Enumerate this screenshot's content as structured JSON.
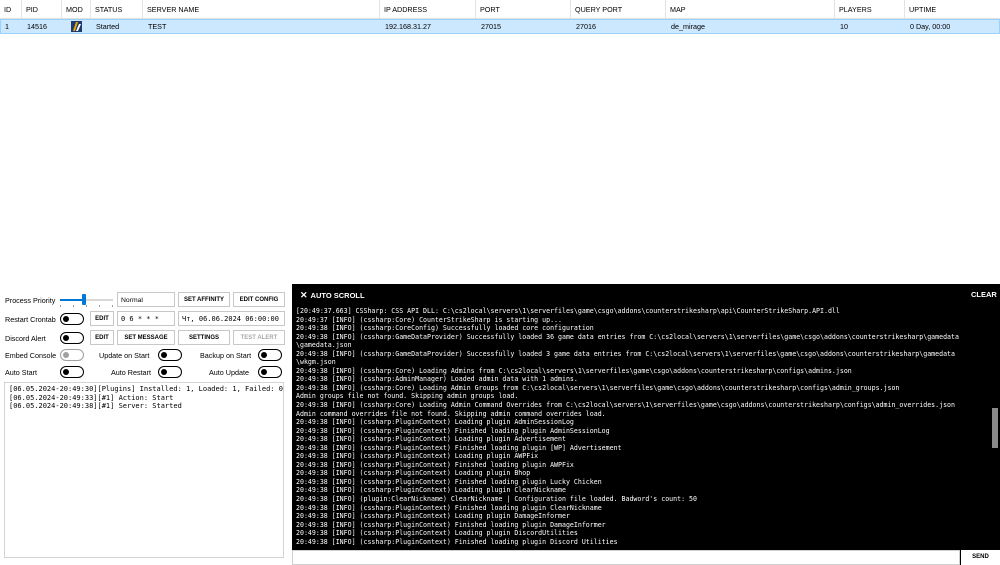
{
  "table": {
    "columns": [
      "ID",
      "PID",
      "MOD",
      "STATUS",
      "SERVER NAME",
      "IP ADDRESS",
      "PORT",
      "QUERY PORT",
      "MAP",
      "PLAYERS",
      "UPTIME"
    ],
    "rows": [
      {
        "id": "1",
        "pid": "14516",
        "mod_icon": "cs2-game-icon",
        "status": "Started",
        "server_name": "TEST",
        "ip": "192.168.31.27",
        "port": "27015",
        "query_port": "27016",
        "map": "de_mirage",
        "players": "10",
        "uptime": "0 Day, 00:00"
      }
    ]
  },
  "controls": {
    "process_priority_label": "Process Priority",
    "process_priority_level": 0.45,
    "priority_value": "Normal",
    "set_affinity": "SET AFFINITY",
    "edit_config": "EDIT CONFIG",
    "restart_crontab_label": "Restart Crontab",
    "edit": "EDIT",
    "crontab_value": "0 6 * * *",
    "next_restart": "Чт, 06.06.2024 06:00:00",
    "discord_alert_label": "Discord Alert",
    "set_message": "SET MESSAGE",
    "settings": "SETTINGS",
    "test_alert": "TEST ALERT",
    "embed_console_label": "Embed Console",
    "update_on_start_label": "Update on Start",
    "backup_on_start_label": "Backup on Start",
    "auto_start_label": "Auto Start",
    "auto_restart_label": "Auto Restart",
    "auto_update_label": "Auto Update"
  },
  "event_log": [
    "[06.05.2024-20:49:30][Plugins] Installed: 1, Loaded: 1, Failed: 0",
    "[06.05.2024-20:49:33][#1] Action: Start",
    "[06.05.2024-20:49:38][#1] Server: Started"
  ],
  "console": {
    "auto_scroll_label": "AUTO SCROLL",
    "clear_label": "CLEAR",
    "send_label": "SEND",
    "lines": [
      "[20:49:37.663] CSSharp: CSS API DLL: C:\\cs2local\\servers\\1\\serverfiles\\game\\csgo\\addons\\counterstrikesharp\\api\\CounterStrikeSharp.API.dll",
      "20:49:37 [INFO] (cssharp:Core) CounterStrikeSharp is starting up...",
      "20:49:38 [INFO] (cssharp:CoreConfig) Successfully loaded core configuration",
      "20:49:38 [INFO] (cssharp:GameDataProvider) Successfully loaded 36 game data entries from C:\\cs2local\\servers\\1\\serverfiles\\game\\csgo\\addons\\counterstrikesharp\\gamedata",
      "\\gamedata.json",
      "20:49:38 [INFO] (cssharp:GameDataProvider) Successfully loaded 3 game data entries from C:\\cs2local\\servers\\1\\serverfiles\\game\\csgo\\addons\\counterstrikesharp\\gamedata",
      "\\wkgm.json",
      "20:49:38 [INFO] (cssharp:Core) Loading Admins from C:\\cs2local\\servers\\1\\serverfiles\\game\\csgo\\addons\\counterstrikesharp\\configs\\admins.json",
      "20:49:38 [INFO] (cssharp:AdminManager) Loaded admin data with 1 admins.",
      "20:49:38 [INFO] (cssharp:Core) Loading Admin Groups from C:\\cs2local\\servers\\1\\serverfiles\\game\\csgo\\addons\\counterstrikesharp\\configs\\admin_groups.json",
      "Admin groups file not found. Skipping admin groups load.",
      "20:49:38 [INFO] (cssharp:Core) Loading Admin Command Overrides from C:\\cs2local\\servers\\1\\serverfiles\\game\\csgo\\addons\\counterstrikesharp\\configs\\admin_overrides.json",
      "Admin command overrides file not found. Skipping admin command overrides load.",
      "20:49:38 [INFO] (cssharp:PluginContext) Loading plugin AdminSessionLog",
      "20:49:38 [INFO] (cssharp:PluginContext) Finished loading plugin AdminSessionLog",
      "20:49:38 [INFO] (cssharp:PluginContext) Loading plugin Advertisement",
      "20:49:38 [INFO] (cssharp:PluginContext) Finished loading plugin [WP] Advertisement",
      "20:49:38 [INFO] (cssharp:PluginContext) Loading plugin AWPFix",
      "20:49:38 [INFO] (cssharp:PluginContext) Finished loading plugin AWPFix",
      "20:49:38 [INFO] (cssharp:PluginContext) Loading plugin Bhop",
      "20:49:38 [INFO] (cssharp:PluginContext) Finished loading plugin Lucky Chicken",
      "20:49:38 [INFO] (cssharp:PluginContext) Loading plugin ClearNickname",
      "20:49:38 [INFO] (plugin:ClearNickname) ClearNickname | Configuration file loaded. Badword's count: 50",
      "20:49:38 [INFO] (cssharp:PluginContext) Finished loading plugin ClearNickname",
      "20:49:38 [INFO] (cssharp:PluginContext) Loading plugin DamageInformer",
      "20:49:38 [INFO] (cssharp:PluginContext) Finished loading plugin DamageInformer",
      "20:49:38 [INFO] (cssharp:PluginContext) Loading plugin DiscordUtilities",
      "20:49:38 [INFO] (cssharp:PluginContext) Finished loading plugin Discord Utilities"
    ]
  }
}
